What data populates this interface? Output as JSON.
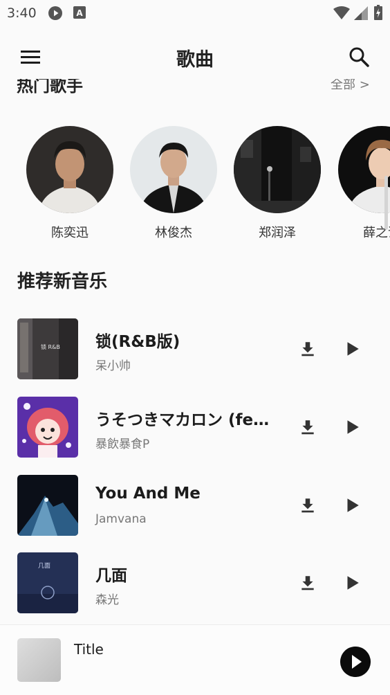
{
  "status_bar": {
    "time": "3:40"
  },
  "app_bar": {
    "title": "歌曲",
    "menu_icon": "menu-icon",
    "search_icon": "search-icon"
  },
  "hot_singers": {
    "title": "热门歌手",
    "more_label": "全部 >",
    "items": [
      {
        "name": "陈奕迅"
      },
      {
        "name": "林俊杰"
      },
      {
        "name": "郑润泽"
      },
      {
        "name": "薛之谦"
      }
    ]
  },
  "recommended": {
    "title": "推荐新音乐",
    "songs": [
      {
        "title": "锁(R&B版)",
        "artist": "呆小帅",
        "cover_text": "锁 R&B"
      },
      {
        "title": "うそつきマカロン (feat. 重音テト)",
        "artist": "暴飲暴食P"
      },
      {
        "title": "You And Me",
        "artist": "Jamvana"
      },
      {
        "title": "几面",
        "artist": "森光",
        "cover_text": "几面"
      }
    ]
  },
  "player": {
    "title": "Title"
  },
  "colors": {
    "background": "#fafafa",
    "accent": "#0b0b0b",
    "secondary_text": "#777777"
  }
}
